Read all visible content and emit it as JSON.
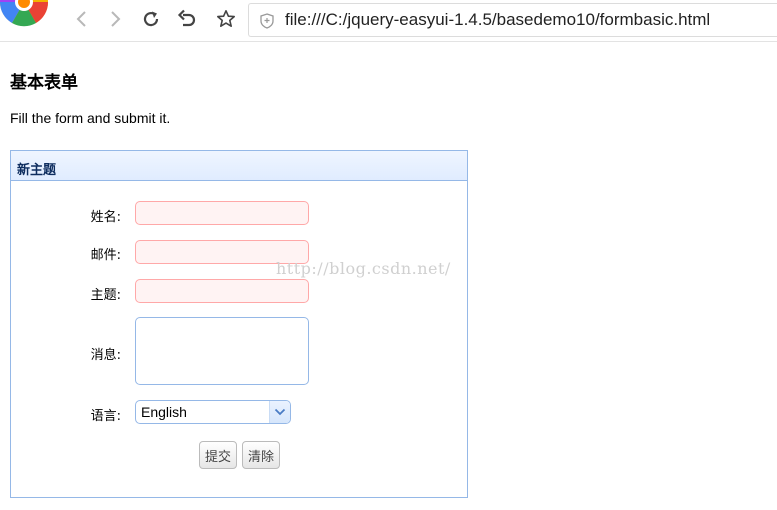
{
  "browser": {
    "url": "file:///C:/jquery-easyui-1.4.5/basedemo10/formbasic.html",
    "icons": [
      "browser-logo-icon",
      "back-arrow-icon",
      "forward-arrow-icon",
      "reload-icon",
      "undo-icon",
      "star-icon",
      "shield-icon"
    ]
  },
  "page": {
    "title": "基本表单",
    "intro": "Fill the form and submit it."
  },
  "panel": {
    "title": "新主题",
    "fields": {
      "name_label": "姓名:",
      "email_label": "邮件:",
      "subject_label": "主题:",
      "message_label": "消息:",
      "language_label": "语言:"
    },
    "language_value": "English",
    "buttons": {
      "submit": "提交",
      "clear": "清除"
    }
  },
  "watermark": "http://blog.csdn.net/",
  "colors": {
    "panel_border": "#95b8e7",
    "panel_header": "#e0ecff",
    "invalid_border": "#ffa8a8",
    "invalid_bg": "#fff3f3"
  }
}
